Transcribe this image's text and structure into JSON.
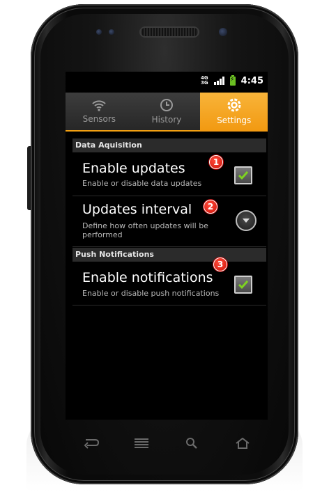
{
  "status_bar": {
    "network_top": "4G",
    "network_bottom": "3G",
    "time": "4:45"
  },
  "tabs": [
    {
      "label": "Sensors",
      "icon": "wifi-icon",
      "active": false
    },
    {
      "label": "History",
      "icon": "clock-icon",
      "active": false
    },
    {
      "label": "Settings",
      "icon": "settings-icon",
      "active": true
    }
  ],
  "sections": {
    "data_aquisition": "Data Aquisition",
    "push_notifications": "Push Notifications"
  },
  "preferences": {
    "enable_updates": {
      "title": "Enable updates",
      "summary": "Enable or disable data updates",
      "checked": true
    },
    "updates_interval": {
      "title": "Updates interval",
      "summary": "Define how often updates will be performed"
    },
    "enable_notifications": {
      "title": "Enable notifications",
      "summary": "Enable or disable push notifications",
      "checked": true
    }
  },
  "callouts": [
    "1",
    "2",
    "3"
  ],
  "nav_keys": [
    "back-icon",
    "menu-icon",
    "search-icon",
    "home-icon"
  ],
  "colors": {
    "accent": "#f29a12",
    "check": "#7ed321",
    "badge": "#e0241a"
  }
}
